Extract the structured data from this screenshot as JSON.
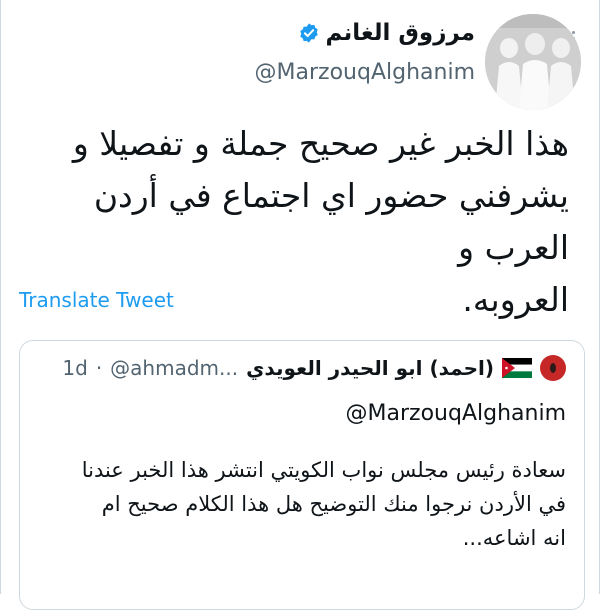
{
  "tweet": {
    "author_name": "مرزوق الغانم",
    "author_handle": "@MarzouqAlghanim",
    "verified_icon": "verified-badge-icon",
    "more_icon": "more-options-icon",
    "text_lines": [
      "هذا الخبر غير صحيح جملة و تفصيلا و",
      "يشرفني حضور اي اجتماع في أردن العرب و",
      "العروبه."
    ],
    "translate_label": "Translate Tweet"
  },
  "quoted_tweet": {
    "author_name": "(احمد) ابو الحيدر العويدي",
    "author_handle": "@ahmadm...",
    "separator": "·",
    "time": "1d",
    "reply_to": "@MarzouqAlghanim",
    "text_lines": [
      "سعادة رئيس مجلس نواب الكويتي انتشر هذا الخبر عندنا",
      "في الأردن نرجوا منك التوضيح هل هذا الكلام صحيح ام",
      "انه اشاعه..."
    ],
    "flag_icon": "jordan-flag-icon",
    "avatar_icon": "red-circle-avatar"
  },
  "colors": {
    "link": "#1d9bf0",
    "secondary_text": "#536471",
    "border": "#cfd9de",
    "verified": "#1d9bf0"
  }
}
